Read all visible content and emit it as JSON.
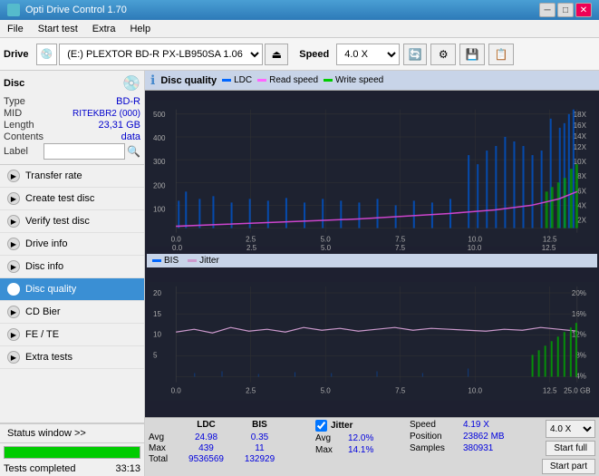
{
  "titlebar": {
    "title": "Opti Drive Control 1.70",
    "minimize": "─",
    "maximize": "□",
    "close": "✕"
  },
  "menubar": {
    "items": [
      "File",
      "Start test",
      "Extra",
      "Help"
    ]
  },
  "toolbar": {
    "drive_label": "Drive",
    "drive_value": "(E:)  PLEXTOR BD-R  PX-LB950SA 1.06",
    "speed_label": "Speed",
    "speed_value": "4.0 X"
  },
  "disc": {
    "title": "Disc",
    "type_label": "Type",
    "type_value": "BD-R",
    "mid_label": "MID",
    "mid_value": "RITEKBR2 (000)",
    "length_label": "Length",
    "length_value": "23,31 GB",
    "contents_label": "Contents",
    "contents_value": "data",
    "label_label": "Label",
    "label_value": ""
  },
  "nav": {
    "items": [
      {
        "id": "transfer-rate",
        "label": "Transfer rate",
        "active": false
      },
      {
        "id": "create-test-disc",
        "label": "Create test disc",
        "active": false
      },
      {
        "id": "verify-test-disc",
        "label": "Verify test disc",
        "active": false
      },
      {
        "id": "drive-info",
        "label": "Drive info",
        "active": false
      },
      {
        "id": "disc-info",
        "label": "Disc info",
        "active": false
      },
      {
        "id": "disc-quality",
        "label": "Disc quality",
        "active": true
      },
      {
        "id": "cd-bier",
        "label": "CD Bier",
        "active": false
      },
      {
        "id": "fe-te",
        "label": "FE / TE",
        "active": false
      },
      {
        "id": "extra-tests",
        "label": "Extra tests",
        "active": false
      }
    ]
  },
  "status": {
    "window_btn": "Status window >>",
    "progress": 100,
    "status_text": "Tests completed",
    "time": "33:13"
  },
  "chart": {
    "title": "Disc quality",
    "legend": [
      {
        "label": "LDC",
        "color": "#0066ff"
      },
      {
        "label": "Read speed",
        "color": "#ff66ff"
      },
      {
        "label": "Write speed",
        "color": "#00cc00"
      }
    ],
    "legend2": [
      {
        "label": "BIS",
        "color": "#0066ff"
      },
      {
        "label": "Jitter",
        "color": "#cc99cc"
      }
    ]
  },
  "stats": {
    "avg_label": "Avg",
    "max_label": "Max",
    "total_label": "Total",
    "ldc_header": "LDC",
    "bis_header": "BIS",
    "jitter_header": "Jitter",
    "ldc_avg": "24.98",
    "ldc_max": "439",
    "ldc_total": "9536569",
    "bis_avg": "0.35",
    "bis_max": "11",
    "bis_total": "132929",
    "jitter_label": "Jitter",
    "jitter_avg": "12.0%",
    "jitter_max": "14.1%",
    "speed_label": "Speed",
    "speed_val": "4.19 X",
    "position_label": "Position",
    "position_val": "23862 MB",
    "samples_label": "Samples",
    "samples_val": "380931",
    "speed_select": "4.0 X",
    "btn_full": "Start full",
    "btn_part": "Start part"
  }
}
